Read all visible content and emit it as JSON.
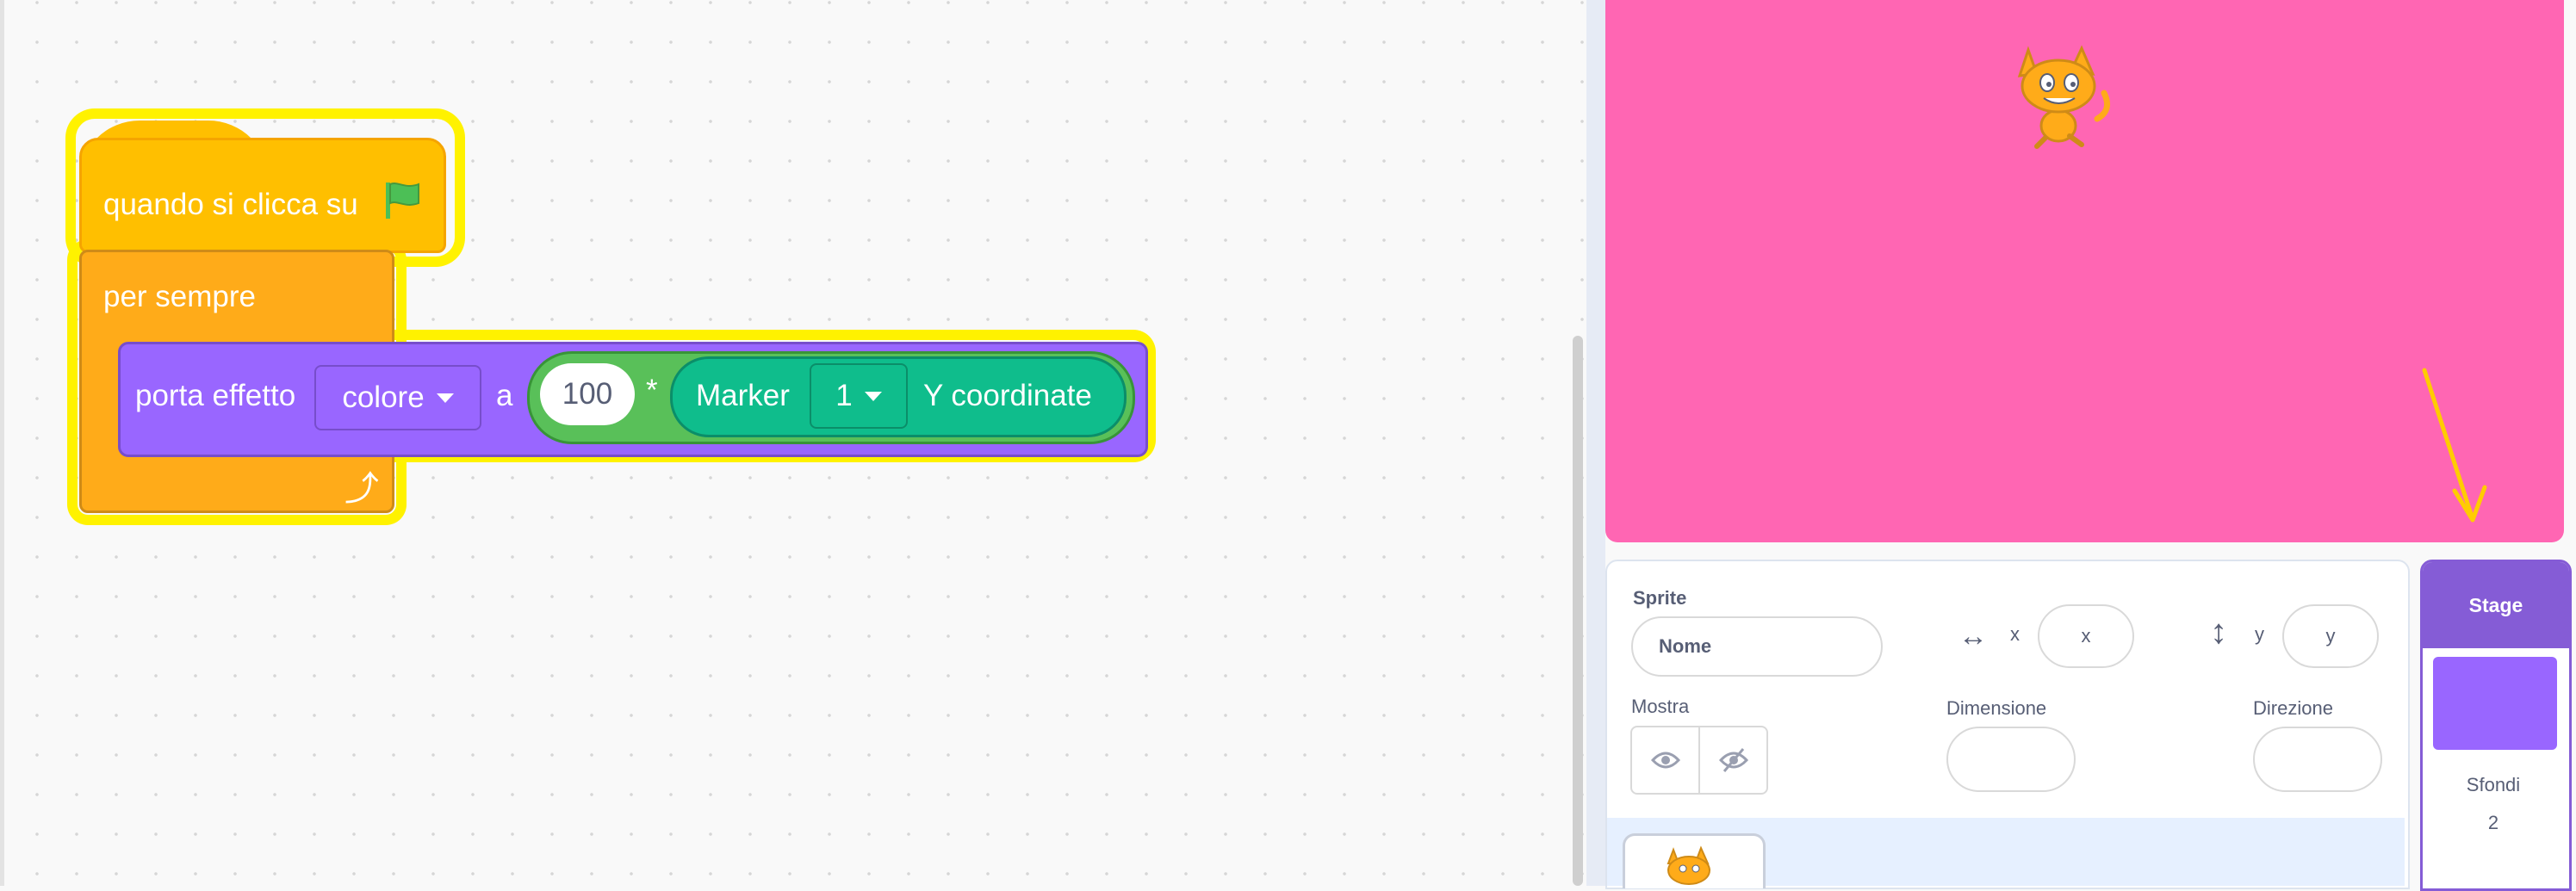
{
  "code": {
    "hat_label": "quando si clicca su",
    "forever_label": "per sempre",
    "effect_label": "porta effetto",
    "effect_dropdown": "colore",
    "to_label": "a",
    "number_value": "100",
    "operator_symbol": "*",
    "sensing_label": "Marker",
    "marker_dropdown": "1",
    "coordinate_label": "Y coordinate"
  },
  "sprite_info": {
    "sprite_label": "Sprite",
    "name_placeholder": "Nome",
    "x_label": "x",
    "x_placeholder": "x",
    "y_label": "y",
    "y_placeholder": "y",
    "show_label": "Mostra",
    "size_label": "Dimensione",
    "direction_label": "Direzione"
  },
  "stage_selector": {
    "title": "Stage",
    "backdrops_label": "Sfondi",
    "backdrops_count": "2"
  },
  "colors": {
    "events": "#ffbf00",
    "control": "#ffab19",
    "looks": "#9966ff",
    "operators": "#59c059",
    "sensing": "#0fbd8c",
    "stage_bg": "#ff66b3",
    "highlight": "#fff200",
    "annotation_arrow": "#ffcc00"
  },
  "icons": [
    "green-flag-icon",
    "loop-arrow-icon",
    "scratch-cat-icon",
    "eye-icon",
    "eye-slash-icon",
    "horizontal-arrows-icon",
    "vertical-arrows-icon"
  ]
}
